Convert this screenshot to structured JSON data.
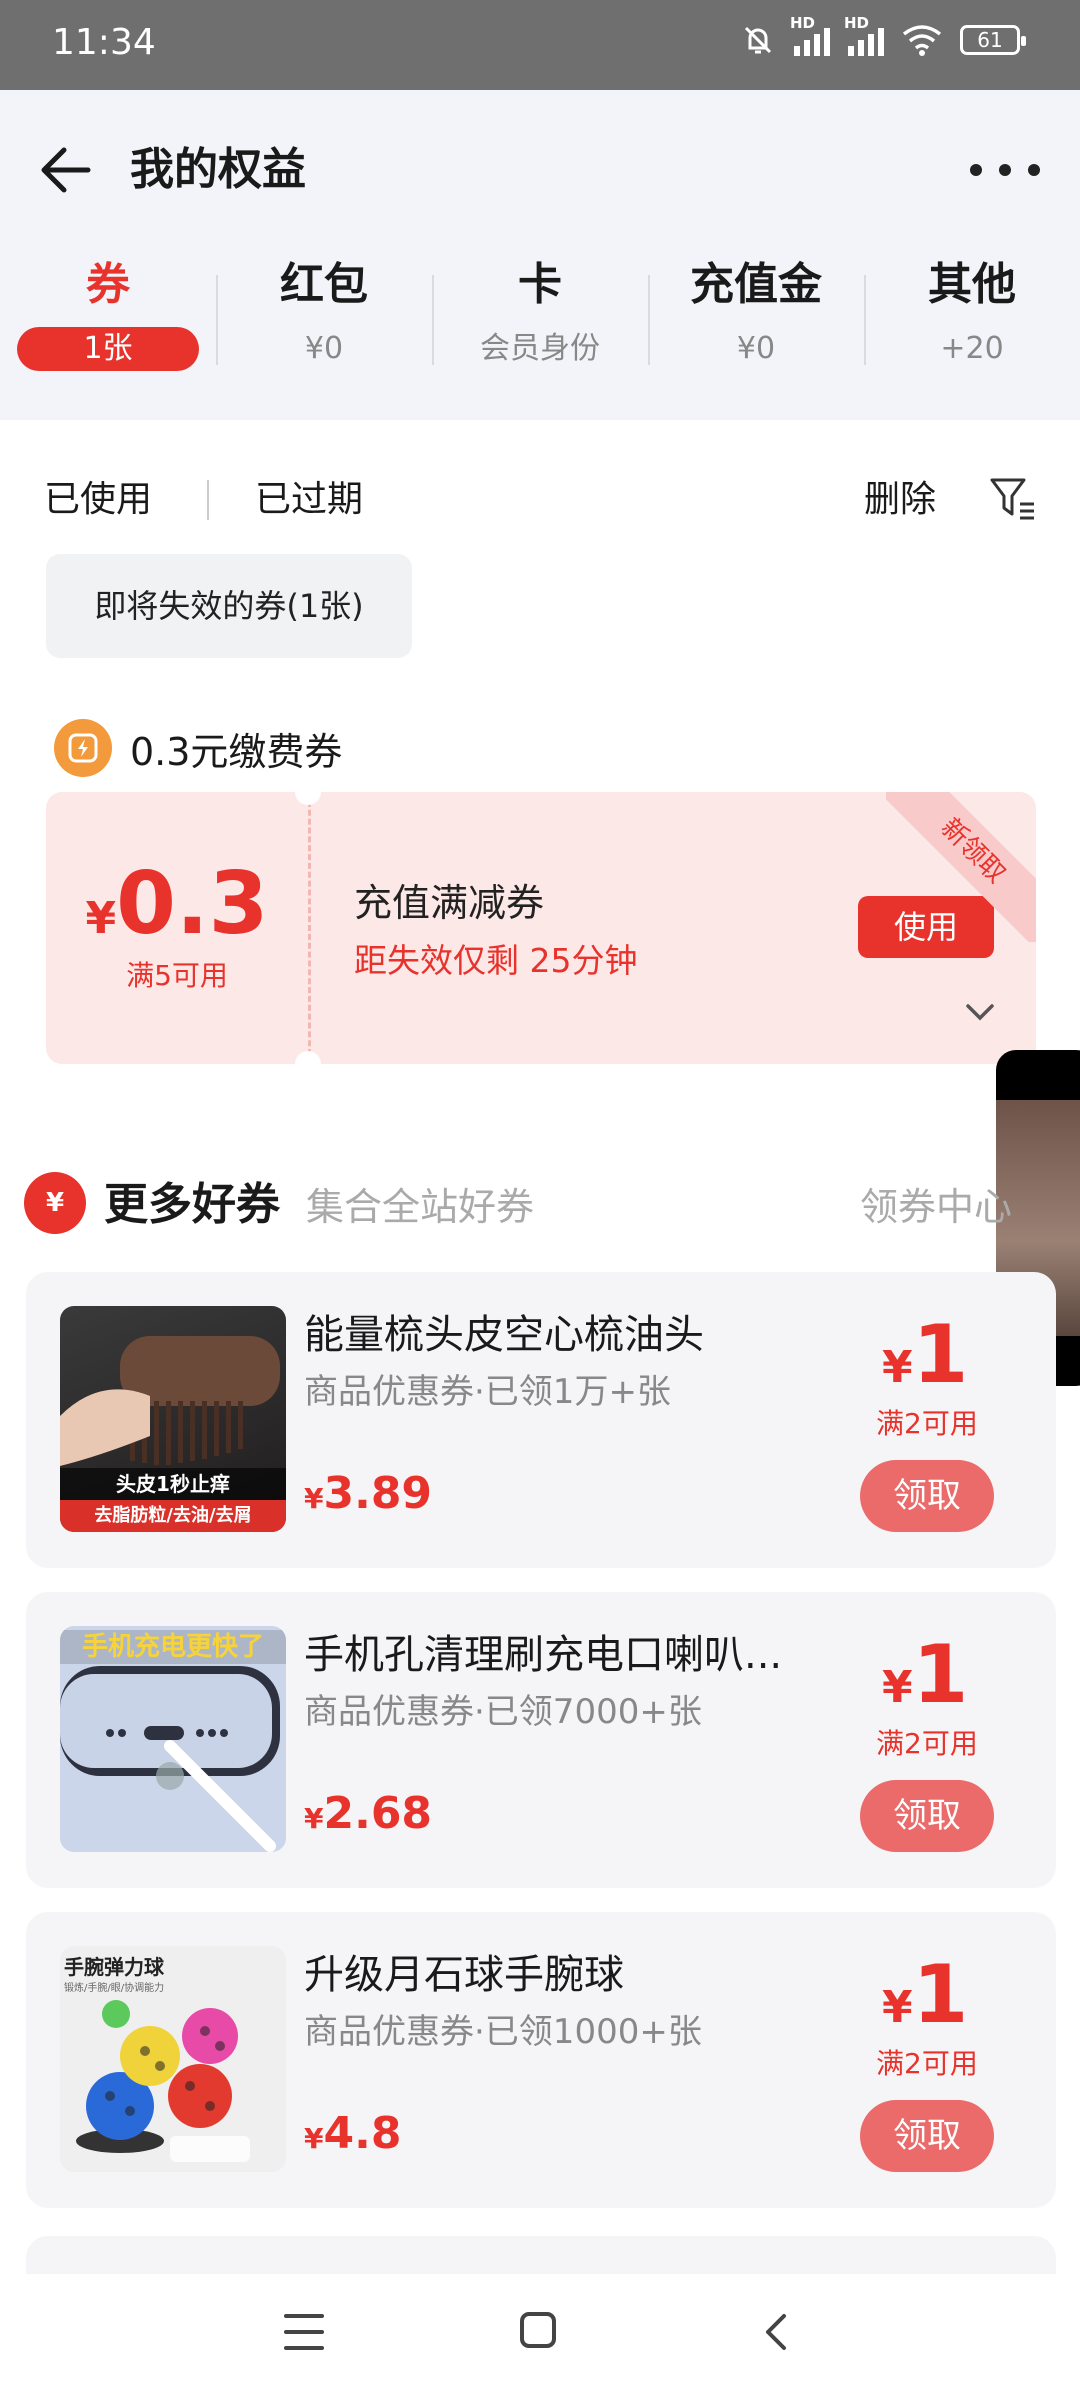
{
  "status_bar": {
    "time": "11:34",
    "hd1": "HD",
    "hd2": "HD",
    "battery": "61"
  },
  "header": {
    "title": "我的权益"
  },
  "tabs": [
    {
      "label": "券",
      "sub": "1张"
    },
    {
      "label": "红包",
      "sub": "¥0"
    },
    {
      "label": "卡",
      "sub": "会员身份"
    },
    {
      "label": "充值金",
      "sub": "¥0"
    },
    {
      "label": "其他",
      "sub": "+20"
    }
  ],
  "filters": {
    "used": "已使用",
    "expired": "已过期",
    "delete": "删除"
  },
  "expiring_chip": "即将失效的券(1张)",
  "coupon_section": {
    "title": "0.3元缴费券",
    "coupon": {
      "currency": "¥",
      "amount": "0.3",
      "condition": "满5可用",
      "name": "充值满减券",
      "expiry": "距失效仅剩 25分钟",
      "use_button": "使用",
      "corner_tag": "新领取"
    }
  },
  "more_section": {
    "icon_text": "¥",
    "title": "更多好券",
    "subtitle": "集合全站好券",
    "link": "领券中心"
  },
  "products": [
    {
      "name": "能量梳头皮空心梳油头",
      "desc": "商品优惠券·已领1万+张",
      "currency": "¥",
      "price": "3.89",
      "coupon_amount": "1",
      "condition": "满2可用",
      "button": "领取",
      "thumb_line1": "头皮1秒止痒",
      "thumb_line2": "去脂肪粒/去油/去屑"
    },
    {
      "name": "手机孔清理刷充电口喇叭...",
      "desc": "商品优惠券·已领7000+张",
      "currency": "¥",
      "price": "2.68",
      "coupon_amount": "1",
      "condition": "满2可用",
      "button": "领取",
      "thumb_line1": "手机充电更快了"
    },
    {
      "name": "升级月石球手腕球",
      "desc": "商品优惠券·已领1000+张",
      "currency": "¥",
      "price": "4.8",
      "coupon_amount": "1",
      "condition": "满2可用",
      "button": "领取",
      "thumb_line1": "手腕弹力球",
      "thumb_line2": "锻炼/手腕/眼/协调能力"
    }
  ],
  "colors": {
    "accent": "#e8332c",
    "header_bg": "#f2f4f9",
    "coupon_bg": "#fde8e8",
    "card_bg": "#f5f5f7"
  }
}
